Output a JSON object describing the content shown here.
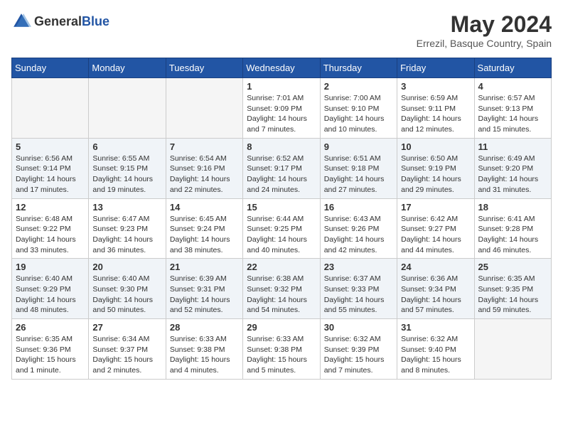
{
  "header": {
    "logo_general": "General",
    "logo_blue": "Blue",
    "title": "May 2024",
    "location": "Errezil, Basque Country, Spain"
  },
  "weekdays": [
    "Sunday",
    "Monday",
    "Tuesday",
    "Wednesday",
    "Thursday",
    "Friday",
    "Saturday"
  ],
  "weeks": [
    [
      {
        "day": "",
        "empty": true
      },
      {
        "day": "",
        "empty": true
      },
      {
        "day": "",
        "empty": true
      },
      {
        "day": "1",
        "sunrise": "Sunrise: 7:01 AM",
        "sunset": "Sunset: 9:09 PM",
        "daylight": "Daylight: 14 hours and 7 minutes."
      },
      {
        "day": "2",
        "sunrise": "Sunrise: 7:00 AM",
        "sunset": "Sunset: 9:10 PM",
        "daylight": "Daylight: 14 hours and 10 minutes."
      },
      {
        "day": "3",
        "sunrise": "Sunrise: 6:59 AM",
        "sunset": "Sunset: 9:11 PM",
        "daylight": "Daylight: 14 hours and 12 minutes."
      },
      {
        "day": "4",
        "sunrise": "Sunrise: 6:57 AM",
        "sunset": "Sunset: 9:13 PM",
        "daylight": "Daylight: 14 hours and 15 minutes."
      }
    ],
    [
      {
        "day": "5",
        "sunrise": "Sunrise: 6:56 AM",
        "sunset": "Sunset: 9:14 PM",
        "daylight": "Daylight: 14 hours and 17 minutes."
      },
      {
        "day": "6",
        "sunrise": "Sunrise: 6:55 AM",
        "sunset": "Sunset: 9:15 PM",
        "daylight": "Daylight: 14 hours and 19 minutes."
      },
      {
        "day": "7",
        "sunrise": "Sunrise: 6:54 AM",
        "sunset": "Sunset: 9:16 PM",
        "daylight": "Daylight: 14 hours and 22 minutes."
      },
      {
        "day": "8",
        "sunrise": "Sunrise: 6:52 AM",
        "sunset": "Sunset: 9:17 PM",
        "daylight": "Daylight: 14 hours and 24 minutes."
      },
      {
        "day": "9",
        "sunrise": "Sunrise: 6:51 AM",
        "sunset": "Sunset: 9:18 PM",
        "daylight": "Daylight: 14 hours and 27 minutes."
      },
      {
        "day": "10",
        "sunrise": "Sunrise: 6:50 AM",
        "sunset": "Sunset: 9:19 PM",
        "daylight": "Daylight: 14 hours and 29 minutes."
      },
      {
        "day": "11",
        "sunrise": "Sunrise: 6:49 AM",
        "sunset": "Sunset: 9:20 PM",
        "daylight": "Daylight: 14 hours and 31 minutes."
      }
    ],
    [
      {
        "day": "12",
        "sunrise": "Sunrise: 6:48 AM",
        "sunset": "Sunset: 9:22 PM",
        "daylight": "Daylight: 14 hours and 33 minutes."
      },
      {
        "day": "13",
        "sunrise": "Sunrise: 6:47 AM",
        "sunset": "Sunset: 9:23 PM",
        "daylight": "Daylight: 14 hours and 36 minutes."
      },
      {
        "day": "14",
        "sunrise": "Sunrise: 6:45 AM",
        "sunset": "Sunset: 9:24 PM",
        "daylight": "Daylight: 14 hours and 38 minutes."
      },
      {
        "day": "15",
        "sunrise": "Sunrise: 6:44 AM",
        "sunset": "Sunset: 9:25 PM",
        "daylight": "Daylight: 14 hours and 40 minutes."
      },
      {
        "day": "16",
        "sunrise": "Sunrise: 6:43 AM",
        "sunset": "Sunset: 9:26 PM",
        "daylight": "Daylight: 14 hours and 42 minutes."
      },
      {
        "day": "17",
        "sunrise": "Sunrise: 6:42 AM",
        "sunset": "Sunset: 9:27 PM",
        "daylight": "Daylight: 14 hours and 44 minutes."
      },
      {
        "day": "18",
        "sunrise": "Sunrise: 6:41 AM",
        "sunset": "Sunset: 9:28 PM",
        "daylight": "Daylight: 14 hours and 46 minutes."
      }
    ],
    [
      {
        "day": "19",
        "sunrise": "Sunrise: 6:40 AM",
        "sunset": "Sunset: 9:29 PM",
        "daylight": "Daylight: 14 hours and 48 minutes."
      },
      {
        "day": "20",
        "sunrise": "Sunrise: 6:40 AM",
        "sunset": "Sunset: 9:30 PM",
        "daylight": "Daylight: 14 hours and 50 minutes."
      },
      {
        "day": "21",
        "sunrise": "Sunrise: 6:39 AM",
        "sunset": "Sunset: 9:31 PM",
        "daylight": "Daylight: 14 hours and 52 minutes."
      },
      {
        "day": "22",
        "sunrise": "Sunrise: 6:38 AM",
        "sunset": "Sunset: 9:32 PM",
        "daylight": "Daylight: 14 hours and 54 minutes."
      },
      {
        "day": "23",
        "sunrise": "Sunrise: 6:37 AM",
        "sunset": "Sunset: 9:33 PM",
        "daylight": "Daylight: 14 hours and 55 minutes."
      },
      {
        "day": "24",
        "sunrise": "Sunrise: 6:36 AM",
        "sunset": "Sunset: 9:34 PM",
        "daylight": "Daylight: 14 hours and 57 minutes."
      },
      {
        "day": "25",
        "sunrise": "Sunrise: 6:35 AM",
        "sunset": "Sunset: 9:35 PM",
        "daylight": "Daylight: 14 hours and 59 minutes."
      }
    ],
    [
      {
        "day": "26",
        "sunrise": "Sunrise: 6:35 AM",
        "sunset": "Sunset: 9:36 PM",
        "daylight": "Daylight: 15 hours and 1 minute."
      },
      {
        "day": "27",
        "sunrise": "Sunrise: 6:34 AM",
        "sunset": "Sunset: 9:37 PM",
        "daylight": "Daylight: 15 hours and 2 minutes."
      },
      {
        "day": "28",
        "sunrise": "Sunrise: 6:33 AM",
        "sunset": "Sunset: 9:38 PM",
        "daylight": "Daylight: 15 hours and 4 minutes."
      },
      {
        "day": "29",
        "sunrise": "Sunrise: 6:33 AM",
        "sunset": "Sunset: 9:38 PM",
        "daylight": "Daylight: 15 hours and 5 minutes."
      },
      {
        "day": "30",
        "sunrise": "Sunrise: 6:32 AM",
        "sunset": "Sunset: 9:39 PM",
        "daylight": "Daylight: 15 hours and 7 minutes."
      },
      {
        "day": "31",
        "sunrise": "Sunrise: 6:32 AM",
        "sunset": "Sunset: 9:40 PM",
        "daylight": "Daylight: 15 hours and 8 minutes."
      },
      {
        "day": "",
        "empty": true
      }
    ]
  ]
}
